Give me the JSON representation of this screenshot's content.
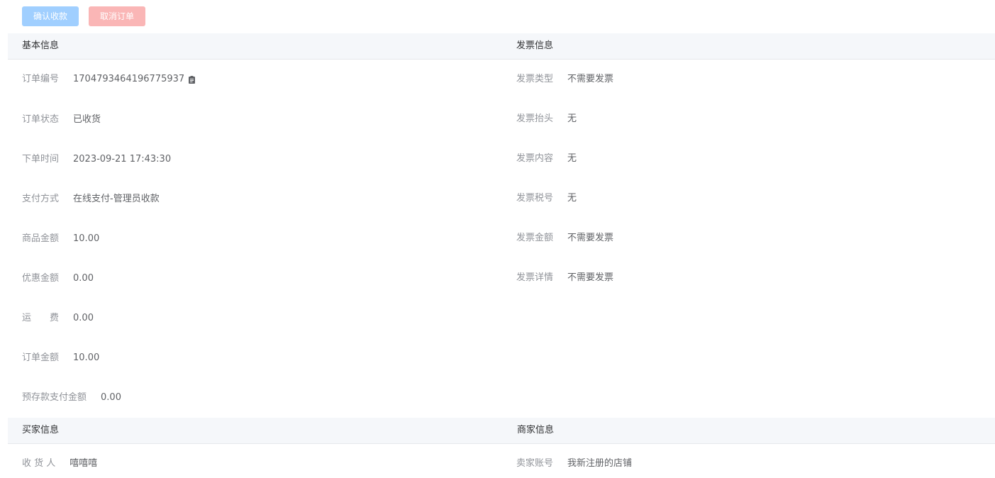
{
  "toolbar": {
    "confirm_label": "确认收款",
    "cancel_label": "取消订单"
  },
  "basic": {
    "title": "基本信息",
    "rows": [
      {
        "label": "订单编号",
        "value": "1704793464196775937"
      },
      {
        "label": "订单状态",
        "value": "已收货"
      },
      {
        "label": "下单时间",
        "value": "2023-09-21 17:43:30"
      },
      {
        "label": "支付方式",
        "value": "在线支付-管理员收款"
      },
      {
        "label": "商品金额",
        "value": "10.00"
      },
      {
        "label": "优惠金额",
        "value": "0.00"
      },
      {
        "label": "运　　费",
        "value": "0.00"
      },
      {
        "label": "订单金额",
        "value": "10.00"
      },
      {
        "label": "预存款支付金额",
        "value": "0.00"
      }
    ]
  },
  "invoice": {
    "title": "发票信息",
    "rows": [
      {
        "label": "发票类型",
        "value": "不需要发票"
      },
      {
        "label": "发票抬头",
        "value": "无"
      },
      {
        "label": "发票内容",
        "value": "无"
      },
      {
        "label": "发票税号",
        "value": "无"
      },
      {
        "label": "发票金额",
        "value": "不需要发票"
      },
      {
        "label": "发票详情",
        "value": "不需要发票"
      }
    ]
  },
  "buyer": {
    "title": "买家信息",
    "rows": [
      {
        "label": "收 货 人",
        "value": "嘻嘻嘻"
      }
    ]
  },
  "seller": {
    "title": "商家信息",
    "rows": [
      {
        "label": "卖家账号",
        "value": "我新注册的店铺"
      }
    ]
  }
}
